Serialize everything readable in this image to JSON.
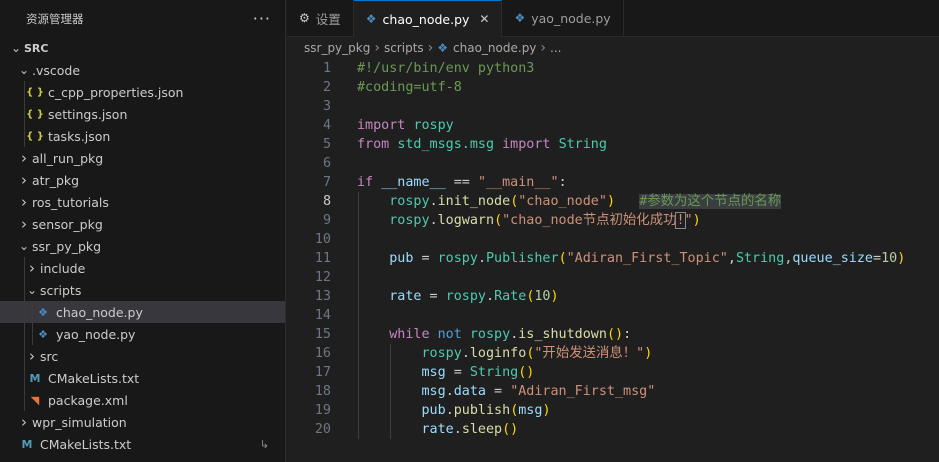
{
  "explorer": {
    "title": "资源管理器",
    "more": "···",
    "items": [
      {
        "label": "SRC",
        "depth": 0,
        "chev": "∨",
        "icon": "",
        "bold": true
      },
      {
        "label": ".vscode",
        "depth": 1,
        "chev": "∨",
        "icon": ""
      },
      {
        "label": "c_cpp_properties.json",
        "depth": 2,
        "chev": "",
        "icon": "json"
      },
      {
        "label": "settings.json",
        "depth": 2,
        "chev": "",
        "icon": "json"
      },
      {
        "label": "tasks.json",
        "depth": 2,
        "chev": "",
        "icon": "json"
      },
      {
        "label": "all_run_pkg",
        "depth": 1,
        "chev": ">",
        "icon": ""
      },
      {
        "label": "atr_pkg",
        "depth": 1,
        "chev": ">",
        "icon": ""
      },
      {
        "label": "ros_tutorials",
        "depth": 1,
        "chev": ">",
        "icon": ""
      },
      {
        "label": "sensor_pkg",
        "depth": 1,
        "chev": ">",
        "icon": ""
      },
      {
        "label": "ssr_py_pkg",
        "depth": 1,
        "chev": "∨",
        "icon": ""
      },
      {
        "label": "include",
        "depth": 2,
        "chev": ">",
        "icon": ""
      },
      {
        "label": "scripts",
        "depth": 2,
        "chev": "∨",
        "icon": ""
      },
      {
        "label": "chao_node.py",
        "depth": 3,
        "chev": "",
        "icon": "py",
        "selected": true
      },
      {
        "label": "yao_node.py",
        "depth": 3,
        "chev": "",
        "icon": "py"
      },
      {
        "label": "src",
        "depth": 2,
        "chev": ">",
        "icon": ""
      },
      {
        "label": "CMakeLists.txt",
        "depth": 2,
        "chev": "",
        "icon": "cmake"
      },
      {
        "label": "package.xml",
        "depth": 2,
        "chev": "",
        "icon": "xml"
      },
      {
        "label": "wpr_simulation",
        "depth": 1,
        "chev": ">",
        "icon": ""
      },
      {
        "label": "CMakeLists.txt",
        "depth": 1,
        "chev": "",
        "icon": "cmake",
        "trailing": "↳"
      }
    ]
  },
  "tabs": [
    {
      "label": "设置",
      "icon": "gear"
    },
    {
      "label": "chao_node.py",
      "icon": "py",
      "active": true,
      "close": "✕"
    },
    {
      "label": "yao_node.py",
      "icon": "py"
    }
  ],
  "breadcrumb": {
    "parts": [
      "ssr_py_pkg",
      "scripts",
      "chao_node.py",
      "..."
    ]
  },
  "code": {
    "current_line": 8,
    "lines": [
      {
        "n": 1,
        "tokens": [
          [
            "cm",
            "#!/usr/bin/env python3"
          ]
        ]
      },
      {
        "n": 2,
        "tokens": [
          [
            "cm",
            "#coding=utf-8"
          ]
        ]
      },
      {
        "n": 3,
        "tokens": []
      },
      {
        "n": 4,
        "tokens": [
          [
            "kw",
            "import"
          ],
          [
            "txt",
            " "
          ],
          [
            "cl",
            "rospy"
          ]
        ]
      },
      {
        "n": 5,
        "tokens": [
          [
            "kw",
            "from"
          ],
          [
            "txt",
            " "
          ],
          [
            "cl",
            "std_msgs.msg"
          ],
          [
            "txt",
            " "
          ],
          [
            "kw",
            "import"
          ],
          [
            "txt",
            " "
          ],
          [
            "cl",
            "String"
          ]
        ]
      },
      {
        "n": 6,
        "tokens": []
      },
      {
        "n": 7,
        "tokens": [
          [
            "kw",
            "if"
          ],
          [
            "txt",
            " "
          ],
          [
            "vr",
            "__name__"
          ],
          [
            "txt",
            " == "
          ],
          [
            "st",
            "\"__main__\""
          ],
          [
            "txt",
            ":"
          ]
        ]
      },
      {
        "n": 8,
        "tokens": [
          [
            "txt",
            "    "
          ],
          [
            "cl",
            "rospy"
          ],
          [
            "txt",
            "."
          ],
          [
            "fn",
            "init_node"
          ],
          [
            "pn",
            "("
          ],
          [
            "st",
            "\"chao_node\""
          ],
          [
            "pn",
            ")"
          ],
          [
            "txt",
            "   "
          ],
          [
            "cmh",
            "#参数为这个节点的名称"
          ]
        ]
      },
      {
        "n": 9,
        "tokens": [
          [
            "txt",
            "    "
          ],
          [
            "cl",
            "rospy"
          ],
          [
            "txt",
            "."
          ],
          [
            "fn",
            "logwarn"
          ],
          [
            "pn",
            "("
          ],
          [
            "st",
            "\"chao_node节点初始化成功"
          ],
          [
            "stb",
            "!"
          ],
          [
            "st",
            "\""
          ],
          [
            "pn",
            ")"
          ]
        ]
      },
      {
        "n": 10,
        "tokens": []
      },
      {
        "n": 11,
        "tokens": [
          [
            "txt",
            "    "
          ],
          [
            "vr",
            "pub"
          ],
          [
            "txt",
            " = "
          ],
          [
            "cl",
            "rospy"
          ],
          [
            "txt",
            "."
          ],
          [
            "cl",
            "Publisher"
          ],
          [
            "pn",
            "("
          ],
          [
            "st",
            "\"Adiran_First_Topic\""
          ],
          [
            "txt",
            ","
          ],
          [
            "cl",
            "String"
          ],
          [
            "txt",
            ","
          ],
          [
            "vr",
            "queue_size"
          ],
          [
            "txt",
            "="
          ],
          [
            "nm",
            "10"
          ],
          [
            "pn",
            ")"
          ]
        ]
      },
      {
        "n": 12,
        "tokens": []
      },
      {
        "n": 13,
        "tokens": [
          [
            "txt",
            "    "
          ],
          [
            "vr",
            "rate"
          ],
          [
            "txt",
            " = "
          ],
          [
            "cl",
            "rospy"
          ],
          [
            "txt",
            "."
          ],
          [
            "cl",
            "Rate"
          ],
          [
            "pn",
            "("
          ],
          [
            "nm",
            "10"
          ],
          [
            "pn",
            ")"
          ]
        ]
      },
      {
        "n": 14,
        "tokens": []
      },
      {
        "n": 15,
        "tokens": [
          [
            "txt",
            "    "
          ],
          [
            "kw",
            "while"
          ],
          [
            "txt",
            " "
          ],
          [
            "kb",
            "not"
          ],
          [
            "txt",
            " "
          ],
          [
            "cl",
            "rospy"
          ],
          [
            "txt",
            "."
          ],
          [
            "fn",
            "is_shutdown"
          ],
          [
            "pn",
            "()"
          ],
          [
            "txt",
            ":"
          ]
        ]
      },
      {
        "n": 16,
        "tokens": [
          [
            "txt",
            "        "
          ],
          [
            "cl",
            "rospy"
          ],
          [
            "txt",
            "."
          ],
          [
            "fn",
            "loginfo"
          ],
          [
            "pn",
            "("
          ],
          [
            "st",
            "\"开始发送消息！\""
          ],
          [
            "pn",
            ")"
          ]
        ]
      },
      {
        "n": 17,
        "tokens": [
          [
            "txt",
            "        "
          ],
          [
            "vr",
            "msg"
          ],
          [
            "txt",
            " = "
          ],
          [
            "cl",
            "String"
          ],
          [
            "pn",
            "()"
          ]
        ]
      },
      {
        "n": 18,
        "tokens": [
          [
            "txt",
            "        "
          ],
          [
            "vr",
            "msg"
          ],
          [
            "txt",
            "."
          ],
          [
            "vr",
            "data"
          ],
          [
            "txt",
            " = "
          ],
          [
            "st",
            "\"Adiran_First_msg\""
          ]
        ]
      },
      {
        "n": 19,
        "tokens": [
          [
            "txt",
            "        "
          ],
          [
            "vr",
            "pub"
          ],
          [
            "txt",
            "."
          ],
          [
            "fn",
            "publish"
          ],
          [
            "pn",
            "("
          ],
          [
            "vr",
            "msg"
          ],
          [
            "pn",
            ")"
          ]
        ]
      },
      {
        "n": 20,
        "tokens": [
          [
            "txt",
            "        "
          ],
          [
            "vr",
            "rate"
          ],
          [
            "txt",
            "."
          ],
          [
            "fn",
            "sleep"
          ],
          [
            "pn",
            "()"
          ]
        ]
      }
    ]
  }
}
